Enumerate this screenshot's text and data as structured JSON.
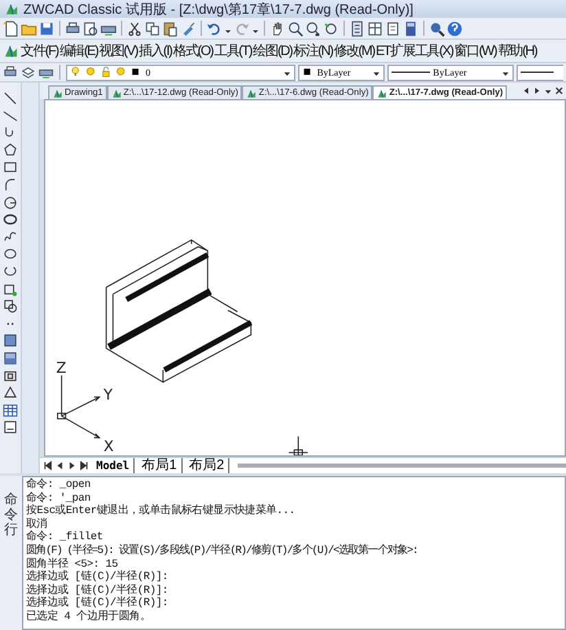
{
  "window": {
    "title": "ZWCAD Classic 试用版 - [Z:\\dwg\\第17章\\17-7.dwg (Read-Only)]"
  },
  "menu": [
    "文件(F)",
    "编辑(E)",
    "视图(V)",
    "插入(I)",
    "格式(O)",
    "工具(T)",
    "绘图(D)",
    "标注(N)",
    "修改(M)",
    "ET扩展工具(X)",
    "窗口(W)",
    "帮助(H)"
  ],
  "layer_toolbar": {
    "layer": "0",
    "color_setting": "ByLayer",
    "linetype": "ByLayer"
  },
  "doc_tabs": [
    {
      "label": "Drawing1",
      "selected": false
    },
    {
      "label": "Z:\\...\\17-12.dwg (Read-Only)",
      "selected": false
    },
    {
      "label": "Z:\\...\\17-6.dwg (Read-Only)",
      "selected": false
    },
    {
      "label": "Z:\\...\\17-7.dwg (Read-Only)",
      "selected": true
    }
  ],
  "axes": {
    "z": "Z",
    "y": "Y",
    "x": "X"
  },
  "layout_tabs": [
    {
      "label": "Model",
      "selected": true
    },
    {
      "label": "布局1",
      "selected": false
    },
    {
      "label": "布局2",
      "selected": false
    }
  ],
  "command": {
    "label": "命令行",
    "lines": [
      "命令: _open",
      "命令: '_pan",
      "按Esc或Enter键退出，或单击鼠标右键显示快捷菜单...",
      "取消",
      "命令: _fillet",
      "圆角(F) (半径=5):  设置(S)/多段线(P)/半径(R)/修剪(T)/多个(U)/<选取第一个对象>:",
      "圆角半径 <5>: 15",
      "选择边或 [链(C)/半径(R)]:",
      "选择边或 [链(C)/半径(R)]:",
      "选择边或 [链(C)/半径(R)]:",
      "已选定 4 个边用于圆角。"
    ]
  }
}
